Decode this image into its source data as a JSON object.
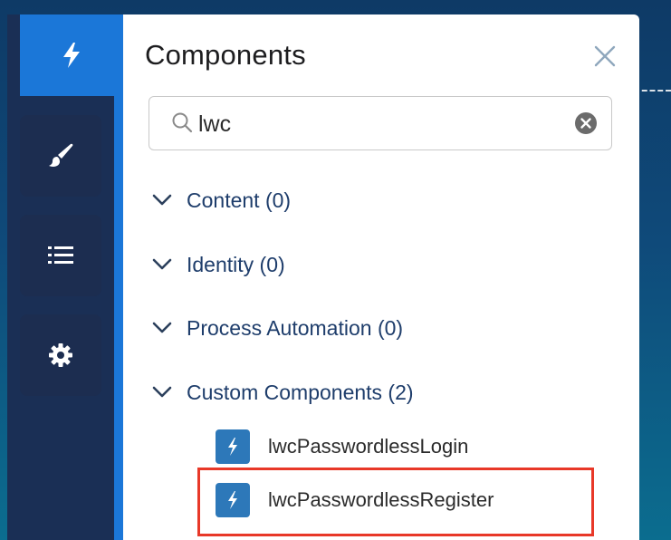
{
  "panel": {
    "title": "Components",
    "close_icon": "close-icon"
  },
  "search": {
    "value": "lwc",
    "search_icon": "search-icon",
    "clear_icon": "clear-circle-icon"
  },
  "sidebar": {
    "items": [
      {
        "icon": "lightning-bolt-icon",
        "active": true
      },
      {
        "icon": "paintbrush-icon",
        "active": false
      },
      {
        "icon": "list-icon",
        "active": false
      },
      {
        "icon": "gear-icon",
        "active": false
      }
    ]
  },
  "sections": [
    {
      "label": "Content (0)"
    },
    {
      "label": "Identity (0)"
    },
    {
      "label": "Process Automation (0)"
    },
    {
      "label": "Custom Components (2)"
    }
  ],
  "components": [
    {
      "name": "lwcPasswordlessLogin",
      "icon": "lightning-component-icon"
    },
    {
      "name": "lwcPasswordlessRegister",
      "icon": "lightning-component-icon",
      "highlighted": true
    }
  ],
  "colors": {
    "accent_blue": "#1b77d8",
    "rail_dark": "#1a2f55",
    "section_text": "#1e3d6b",
    "highlight_red": "#e83828",
    "badge_blue": "#2d78b9"
  }
}
